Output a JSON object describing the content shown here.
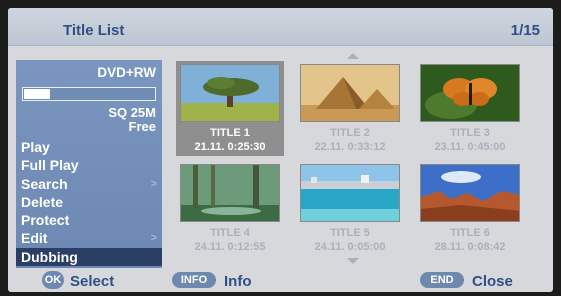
{
  "header": {
    "title": "Title List",
    "page": "1/15"
  },
  "sidebar": {
    "disc_type": "DVD+RW",
    "capacity_fraction": 0.2,
    "quality": "SQ 25M",
    "free_label": "Free",
    "menu": [
      {
        "label": "Play",
        "arrow": ""
      },
      {
        "label": "Full Play",
        "arrow": ""
      },
      {
        "label": "Search",
        "arrow": ">"
      },
      {
        "label": "Delete",
        "arrow": ""
      },
      {
        "label": "Protect",
        "arrow": ""
      },
      {
        "label": "Edit",
        "arrow": ">"
      },
      {
        "label": "Dubbing",
        "arrow": ""
      }
    ],
    "active_index": 6
  },
  "titles": [
    {
      "name": "TITLE 1",
      "info": "21.11.  0:25:30",
      "selected": true,
      "scene": "tree-icon"
    },
    {
      "name": "TITLE 2",
      "info": "22.11.  0:33:12",
      "selected": false,
      "scene": "pyramids-icon"
    },
    {
      "name": "TITLE 3",
      "info": "23.11.  0:45:00",
      "selected": false,
      "scene": "butterfly-icon"
    },
    {
      "name": "TITLE 4",
      "info": "24.11.  0:12:55",
      "selected": false,
      "scene": "forest-icon"
    },
    {
      "name": "TITLE 5",
      "info": "24.11.  0:05:00",
      "selected": false,
      "scene": "beach-icon"
    },
    {
      "name": "TITLE 6",
      "info": "28.11.  0:08:42",
      "selected": false,
      "scene": "canyon-icon"
    }
  ],
  "footer": {
    "ok_key": "OK",
    "ok_label": "Select",
    "info_key": "INFO",
    "info_label": "Info",
    "end_key": "END",
    "end_label": "Close"
  },
  "colors": {
    "panel": "#d6d8db",
    "sidebar": "#7a96bf",
    "active": "#2b3f66",
    "accent_text": "#2f4f86"
  }
}
